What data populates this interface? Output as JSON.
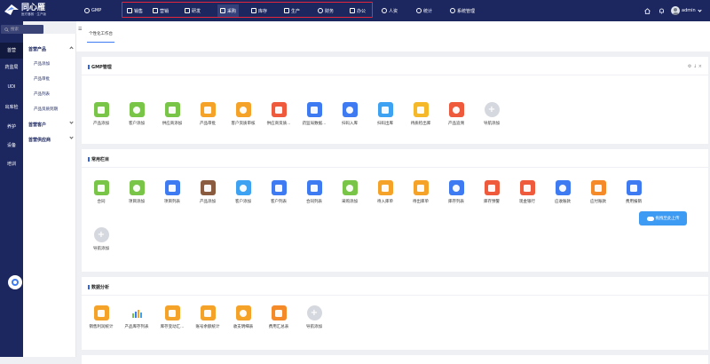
{
  "app": {
    "title": "同心雁",
    "subtitle": "医疗器械 · 生产版"
  },
  "topnav": {
    "items": [
      {
        "label": "GMP",
        "icon": "gear-icon"
      },
      {
        "label": "销售",
        "icon": "sales-icon"
      },
      {
        "label": "营销",
        "icon": "chart-icon"
      },
      {
        "label": "研发",
        "icon": "flask-icon"
      },
      {
        "label": "采购",
        "icon": "cart-icon"
      },
      {
        "label": "库存",
        "icon": "warehouse-icon"
      },
      {
        "label": "生产",
        "icon": "factory-icon"
      },
      {
        "label": "财务",
        "icon": "money-icon"
      },
      {
        "label": "办公",
        "icon": "briefcase-icon"
      },
      {
        "label": "人资",
        "icon": "user-icon"
      },
      {
        "label": "统计",
        "icon": "clock-icon"
      },
      {
        "label": "系统管理",
        "icon": "settings-icon"
      }
    ],
    "active": "采购",
    "user": "admin"
  },
  "sidebar": {
    "search_placeholder": "搜索",
    "items": [
      "首营",
      "药监局",
      "UDI",
      "出库检",
      "养护",
      "设备",
      "培训"
    ]
  },
  "subsidebar": {
    "groups": [
      {
        "label": "首营产品",
        "items": [
          "产品添加",
          "产品审批",
          "产品列表",
          "产品资质到期"
        ]
      },
      {
        "label": "首营客户",
        "items": []
      },
      {
        "label": "首营供应商",
        "items": []
      }
    ]
  },
  "tabs": [
    "个性化工作台"
  ],
  "cards": {
    "gmp": {
      "title": "GMP管理",
      "tiles": [
        {
          "label": "产品添加",
          "color": "#79c548"
        },
        {
          "label": "客户添加",
          "color": "#79c548"
        },
        {
          "label": "供应商添加",
          "color": "#79c548"
        },
        {
          "label": "产品审批",
          "color": "#f5a328"
        },
        {
          "label": "客户资质审核",
          "color": "#f5a328"
        },
        {
          "label": "供应商资质...",
          "color": "#ef5a3c"
        },
        {
          "label": "药监局数据...",
          "color": "#3e7bf2"
        },
        {
          "label": "扫码入库",
          "color": "#3e7bf2"
        },
        {
          "label": "扫码出库",
          "color": "#3ea2f2"
        },
        {
          "label": "待质检出库",
          "color": "#f5b828"
        },
        {
          "label": "产品追溯",
          "color": "#ef5a3c"
        },
        {
          "label": "导航添加",
          "color": "#d5d8de"
        }
      ]
    },
    "common": {
      "title": "常用栏目",
      "tiles": [
        {
          "label": "合同",
          "color": "#79c548"
        },
        {
          "label": "项目添加",
          "color": "#79c548"
        },
        {
          "label": "项目列表",
          "color": "#3e7bf2"
        },
        {
          "label": "产品添加",
          "color": "#8a5b3e"
        },
        {
          "label": "客户添加",
          "color": "#3ea2f2"
        },
        {
          "label": "客户列表",
          "color": "#3e7bf2"
        },
        {
          "label": "合同列表",
          "color": "#3e7bf2"
        },
        {
          "label": "采购添加",
          "color": "#79c548"
        },
        {
          "label": "待入库单",
          "color": "#f5a328"
        },
        {
          "label": "待出库单",
          "color": "#f5a328"
        },
        {
          "label": "库存列表",
          "color": "#3e7bf2"
        },
        {
          "label": "库存预警",
          "color": "#ef5a3c"
        },
        {
          "label": "现金银行",
          "color": "#ef5a3c"
        },
        {
          "label": "应收账款",
          "color": "#3e7bf2"
        },
        {
          "label": "应付账款",
          "color": "#f58a28"
        },
        {
          "label": "费用报销",
          "color": "#3e7bf2"
        },
        {
          "label": "导航添加",
          "color": "#d5d8de"
        }
      ],
      "upload_label": "拖拽至此上传"
    },
    "analysis": {
      "title": "数据分析",
      "tiles": [
        {
          "label": "销售利润统计",
          "color": "#f5a328"
        },
        {
          "label": "产品库存列表",
          "color": "#ffffff"
        },
        {
          "label": "库存变动汇...",
          "color": "#f5a328"
        },
        {
          "label": "账号余额统计",
          "color": "#f5a328"
        },
        {
          "label": "收支明细表",
          "color": "#f5a328"
        },
        {
          "label": "费用汇总表",
          "color": "#f58a28"
        },
        {
          "label": "导航添加",
          "color": "#d5d8de"
        }
      ]
    }
  }
}
